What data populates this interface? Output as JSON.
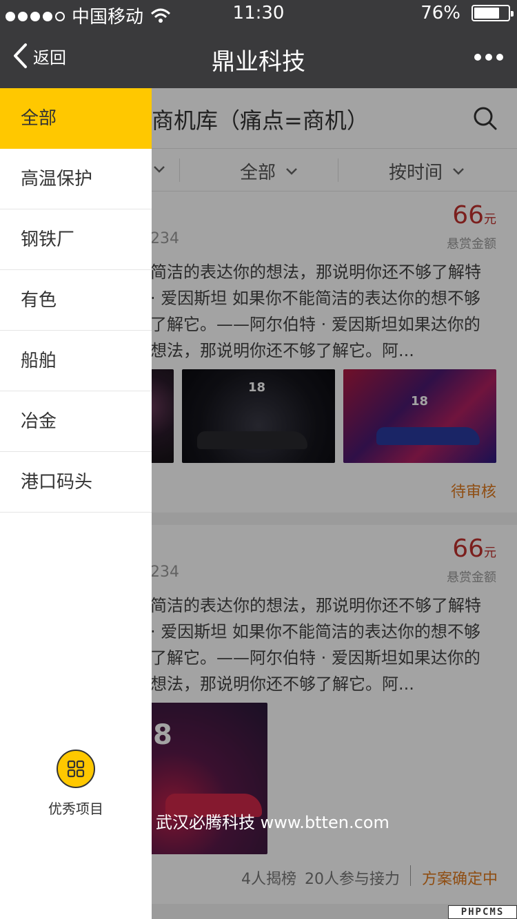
{
  "status_bar": {
    "carrier": "中国移动",
    "time": "11:30",
    "battery": "76%",
    "battery_level": 0.76,
    "signal_filled": 4,
    "signal_total": 5
  },
  "nav": {
    "back_label": "返回",
    "title": "鼎业科技"
  },
  "page": {
    "title": "商机库（痛点=商机）"
  },
  "filters": [
    {
      "label": "全部"
    },
    {
      "label": "按时间"
    }
  ],
  "cards": [
    {
      "reward_value": "66",
      "reward_unit": "元",
      "reward_label": "悬赏金额",
      "id_fragment": "234",
      "description": "简洁的表达你的想法，那说明你还不够了解特 · 爱因斯坦  如果你不能简洁的表达你的想不够了解它。——阿尔伯特 · 爱因斯坦如果达你的想法，那说明你还不够了解它。阿...",
      "status": "待审核",
      "image_badges": [
        "18",
        "18"
      ]
    },
    {
      "reward_value": "66",
      "reward_unit": "元",
      "reward_label": "悬赏金额",
      "id_fragment": "234",
      "description": "简洁的表达你的想法，那说明你还不够了解特 · 爱因斯坦  如果你不能简洁的表达你的想不够了解它。——阿尔伯特 · 爱因斯坦如果达你的想法，那说明你还不够了解它。阿...",
      "participants_claimed": "4人揭榜",
      "participants_relay": "20人参与接力",
      "status": "方案确定中",
      "image_badges": [
        "8"
      ]
    }
  ],
  "watermark": "武汉必腾科技 www.btten.com",
  "corner_logo": "PHPCMS",
  "drawer": {
    "items": [
      "全部",
      "高温保护",
      "钢铁厂",
      "有色",
      "船舶",
      "冶金",
      "港口码头"
    ],
    "active_index": 0,
    "featured_label": "优秀项目"
  },
  "colors": {
    "bar_bg": "#3a3a3c",
    "accent": "#ffc800",
    "reward": "#c0312e",
    "status": "#e07a1f"
  }
}
